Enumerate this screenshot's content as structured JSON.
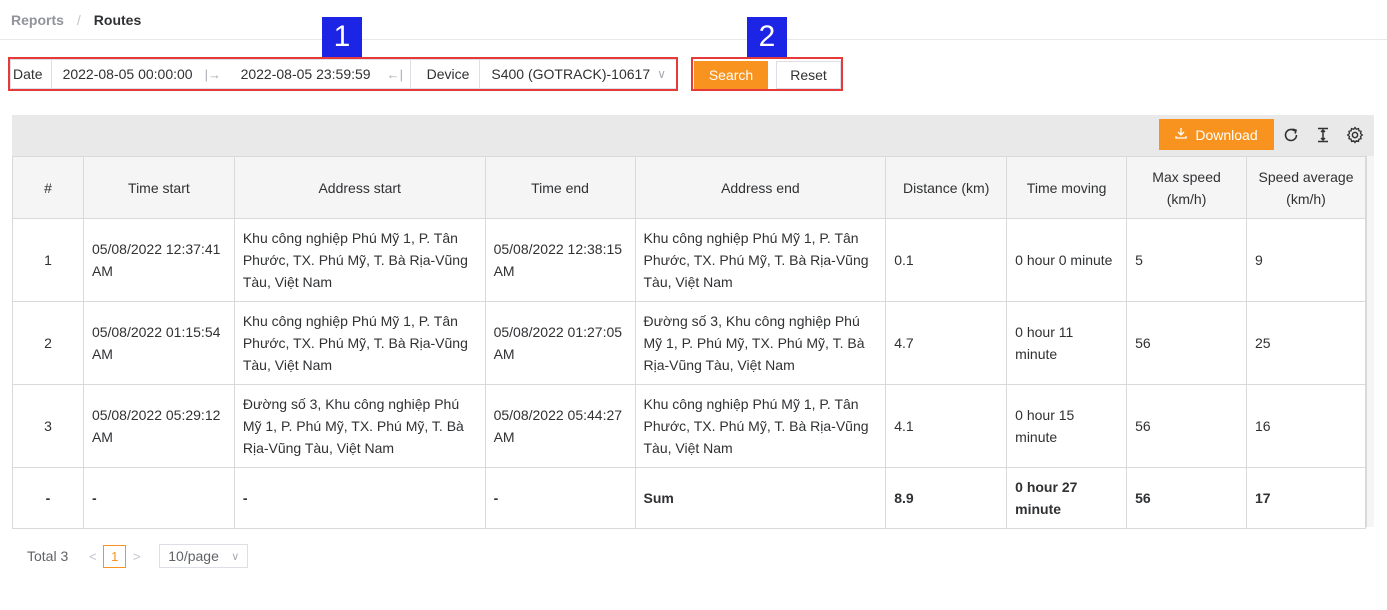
{
  "breadcrumb": {
    "parent": "Reports",
    "separator": "/",
    "current": "Routes"
  },
  "filter": {
    "date_label": "Date",
    "date_start": "2022-08-05 00:00:00",
    "date_end": "2022-08-05 23:59:59",
    "device_label": "Device",
    "device_value": "S400 (GOTRACK)-10617"
  },
  "markers": {
    "one": "1",
    "two": "2"
  },
  "buttons": {
    "search": "Search",
    "reset": "Reset",
    "download": "Download"
  },
  "table": {
    "headers": [
      "#",
      "Time start",
      "Address start",
      "Time end",
      "Address end",
      "Distance (km)",
      "Time moving",
      "Max speed (km/h)",
      "Speed average (km/h)"
    ],
    "rows": [
      {
        "idx": "1",
        "time_start": "05/08/2022 12:37:41 AM",
        "address_start": "Khu công nghiệp Phú Mỹ 1, P. Tân Phước, TX. Phú Mỹ, T. Bà Rịa-Vũng Tàu, Việt Nam",
        "time_end": "05/08/2022 12:38:15 AM",
        "address_end": "Khu công nghiệp Phú Mỹ 1, P. Tân Phước, TX. Phú Mỹ, T. Bà Rịa-Vũng Tàu, Việt Nam",
        "distance": "0.1",
        "time_moving": "0 hour 0 minute",
        "max_speed": "5",
        "speed_avg": "9"
      },
      {
        "idx": "2",
        "time_start": "05/08/2022 01:15:54 AM",
        "address_start": "Khu công nghiệp Phú Mỹ 1, P. Tân Phước, TX. Phú Mỹ, T. Bà Rịa-Vũng Tàu, Việt Nam",
        "time_end": "05/08/2022 01:27:05 AM",
        "address_end": "Đường số 3, Khu công nghiệp Phú Mỹ 1, P. Phú Mỹ, TX. Phú Mỹ, T. Bà Rịa-Vũng Tàu, Việt Nam",
        "distance": "4.7",
        "time_moving": "0 hour 11 minute",
        "max_speed": "56",
        "speed_avg": "25"
      },
      {
        "idx": "3",
        "time_start": "05/08/2022 05:29:12 AM",
        "address_start": "Đường số 3, Khu công nghiệp Phú Mỹ 1, P. Phú Mỹ, TX. Phú Mỹ, T. Bà Rịa-Vũng Tàu, Việt Nam",
        "time_end": "05/08/2022 05:44:27 AM",
        "address_end": "Khu công nghiệp Phú Mỹ 1, P. Tân Phước, TX. Phú Mỹ, T. Bà Rịa-Vũng Tàu, Việt Nam",
        "distance": "4.1",
        "time_moving": "0 hour 15 minute",
        "max_speed": "56",
        "speed_avg": "16"
      }
    ],
    "sum_row": {
      "idx": "-",
      "time_start": "-",
      "address_start": "-",
      "time_end": "-",
      "address_end": "Sum",
      "distance": "8.9",
      "time_moving": "0 hour 27 minute",
      "max_speed": "56",
      "speed_avg": "17"
    }
  },
  "pagination": {
    "total": "Total 3",
    "page": "1",
    "page_size": "10/page"
  },
  "icons": {
    "refresh": "refresh-icon",
    "column_height": "column-height-icon",
    "settings": "gear-icon",
    "download": "download-icon"
  },
  "colors": {
    "accent": "#f7931e",
    "highlight_box": "#e5393a",
    "marker_bg": "#1c24e6"
  }
}
